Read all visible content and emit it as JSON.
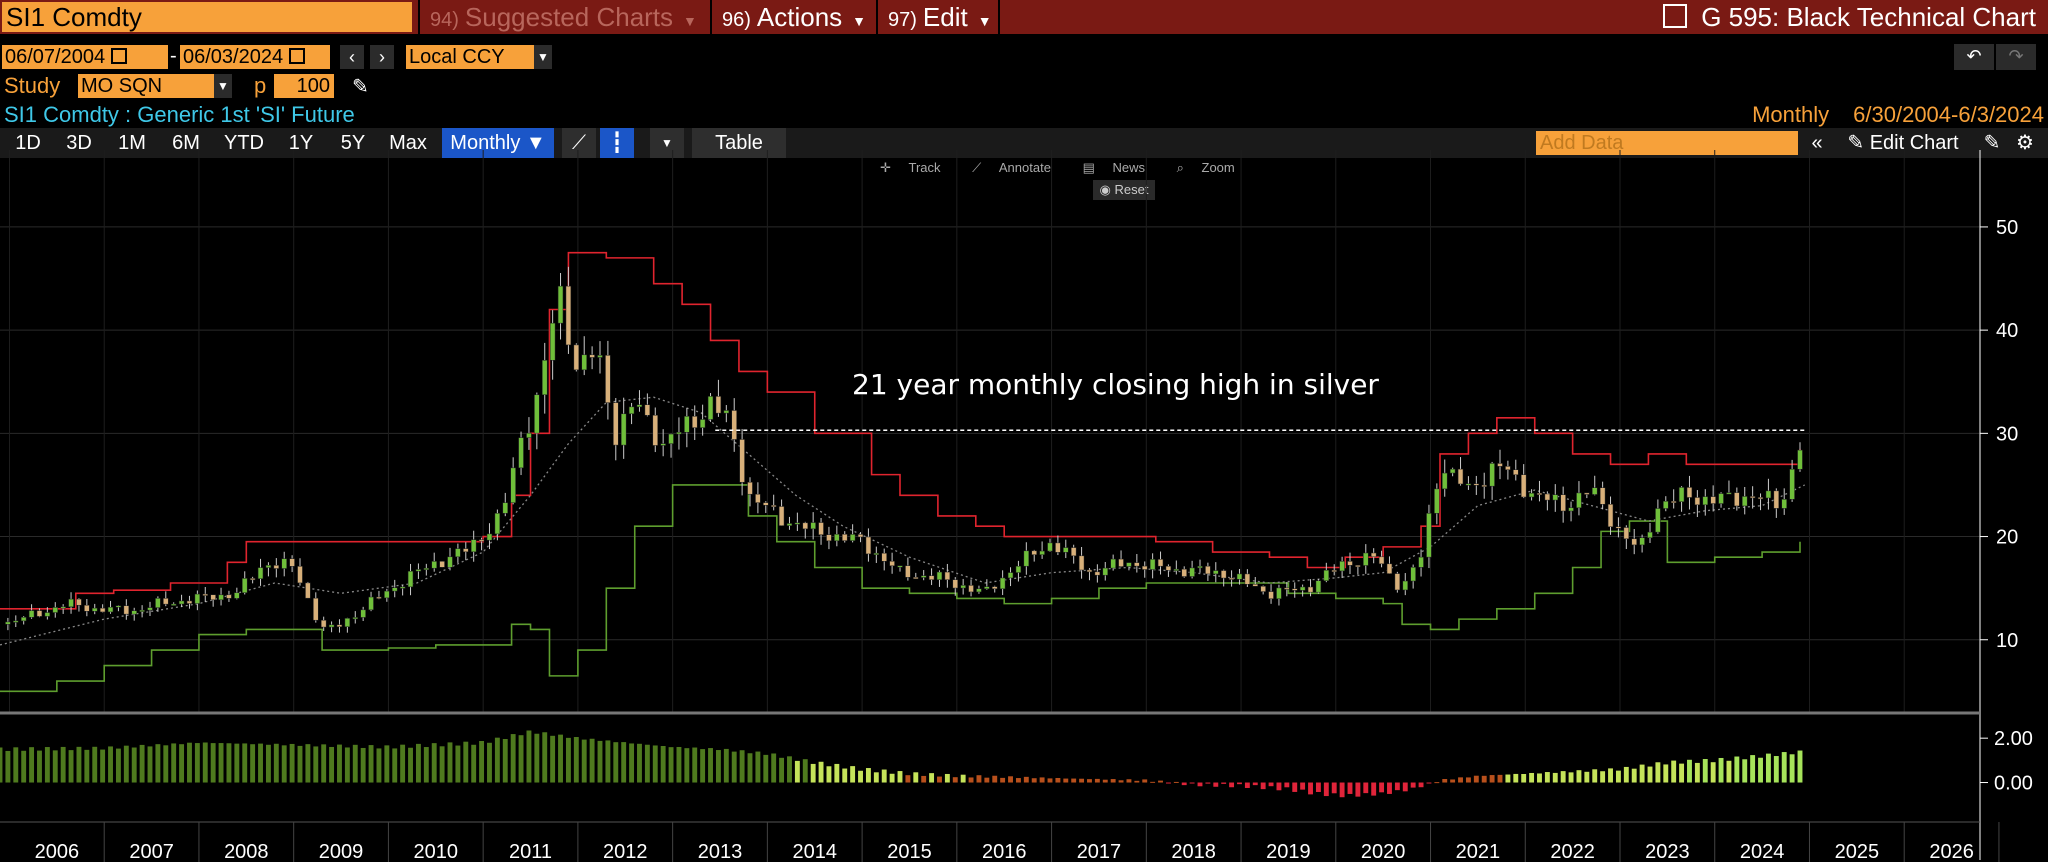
{
  "header": {
    "ticker": "SI1 Comdty",
    "menu_suggested_num": "94)",
    "menu_suggested": "Suggested Charts",
    "menu_actions_num": "96)",
    "menu_actions": "Actions",
    "menu_edit_num": "97)",
    "menu_edit": "Edit",
    "chart_title": "G 595: Black Technical Chart"
  },
  "controls": {
    "start_date": "06/07/2004",
    "end_date": "06/03/2024",
    "currency": "Local CCY",
    "study_label": "Study",
    "study_value": "MO SQN",
    "p_label": "p",
    "p_value": "100",
    "security_description": "SI1 Comdty : Generic 1st 'SI' Future",
    "frequency_label": "Monthly",
    "date_range": "6/30/2004-6/3/2024"
  },
  "toolbar": {
    "periods": [
      "1D",
      "3D",
      "1M",
      "6M",
      "YTD",
      "1Y",
      "5Y",
      "Max"
    ],
    "frequency_button": "Monthly",
    "table_button": "Table",
    "add_data_placeholder": "Add Data",
    "edit_chart": "Edit Chart",
    "chart_tools": [
      "Track",
      "Annotate",
      "News",
      "Zoom"
    ],
    "reset": "Reset"
  },
  "colors": {
    "accent_orange": "#f7a13a",
    "header_red": "#7a1a14",
    "upper_band": "#e0242e",
    "lower_band": "#5e9e2e",
    "up_candle": "#6fbf3a",
    "down_candle": "#d8b07a",
    "selected_blue": "#1b56c8"
  },
  "chart_data": {
    "type": "line",
    "description_series": "SI1 Comdty monthly candlestick with channel bands",
    "x_ticks": [
      "2006",
      "2007",
      "2008",
      "2009",
      "2010",
      "2011",
      "2012",
      "2013",
      "2014",
      "2015",
      "2016",
      "2017",
      "2018",
      "2019",
      "2020",
      "2021",
      "2022",
      "2023",
      "2024",
      "2025",
      "2026"
    ],
    "y_ticks": [
      10,
      20,
      30,
      40,
      50
    ],
    "ylim": [
      3,
      56
    ],
    "xlim": [
      2005.4,
      2026.3
    ],
    "annotation": "21 year monthly closing high in silver",
    "annotation_level": 30.3,
    "price_x": [
      2005.4,
      2005.8,
      2006.1,
      2006.4,
      2006.8,
      2007.1,
      2007.5,
      2007.9,
      2008.2,
      2008.5,
      2008.8,
      2008.95,
      2009.3,
      2009.7,
      2010.0,
      2010.3,
      2010.7,
      2010.9,
      2011.1,
      2011.3,
      2011.5,
      2011.7,
      2011.9,
      2012.1,
      2012.4,
      2012.7,
      2012.9,
      2013.1,
      2013.3,
      2013.6,
      2014.0,
      2014.5,
      2014.9,
      2015.3,
      2015.8,
      2016.1,
      2016.5,
      2016.9,
      2017.3,
      2017.8,
      2018.3,
      2018.8,
      2019.2,
      2019.6,
      2019.9,
      2020.2,
      2020.4,
      2020.6,
      2020.9,
      2021.2,
      2021.6,
      2021.9,
      2022.2,
      2022.5,
      2022.7,
      2022.9,
      2023.2,
      2023.5,
      2023.9,
      2024.2,
      2024.35,
      2024.45
    ],
    "price_y": [
      11.5,
      12.5,
      13.5,
      13.0,
      12.8,
      13.5,
      14.0,
      14.5,
      17.5,
      17.0,
      11.0,
      11.2,
      13.5,
      16.0,
      17.5,
      18.5,
      22.0,
      29.5,
      34.0,
      44.0,
      36.0,
      38.0,
      30.0,
      33.0,
      29.0,
      31.0,
      33.0,
      31.0,
      24.0,
      22.0,
      20.5,
      19.5,
      16.5,
      16.0,
      14.5,
      17.0,
      19.5,
      16.5,
      17.5,
      16.8,
      16.5,
      14.5,
      15.0,
      17.5,
      18.0,
      15.0,
      18.0,
      27.0,
      24.5,
      27.0,
      24.0,
      23.0,
      24.5,
      20.5,
      18.5,
      23.0,
      24.0,
      23.5,
      24.0,
      23.0,
      27.5,
      30.3
    ],
    "series": [
      {
        "name": "",
        "x": [
          2005.4,
          2006.2,
          2006.6,
          2007.2,
          2007.8,
          2008.0,
          2008.7,
          2009.2,
          2009.8,
          2010.2,
          2010.5,
          2010.8,
          2011.0,
          2011.2,
          2011.4,
          2011.8,
          2012.3,
          2012.6,
          2012.9,
          2013.2,
          2013.5,
          2013.8,
          2014.0,
          2014.3,
          2014.6,
          2014.9,
          2015.3,
          2015.7,
          2016.0,
          2016.5,
          2017.0,
          2017.6,
          2018.2,
          2018.8,
          2019.2,
          2019.6,
          2020.0,
          2020.4,
          2020.6,
          2020.9,
          2021.2,
          2021.6,
          2022.0,
          2022.4,
          2022.8,
          2023.2,
          2023.6,
          2024.0,
          2024.4
        ],
        "y": [
          13.0,
          14.5,
          14.8,
          15.5,
          17.5,
          19.5,
          19.5,
          19.5,
          19.5,
          19.5,
          20.0,
          24.0,
          30.0,
          42.0,
          47.5,
          47.0,
          44.5,
          42.5,
          39.0,
          36.0,
          34.0,
          34.0,
          30.0,
          30.0,
          26.0,
          24.0,
          22.0,
          21.0,
          20.0,
          20.0,
          20.0,
          19.5,
          18.5,
          18.0,
          17.0,
          18.0,
          19.0,
          21.0,
          28.0,
          30.0,
          31.5,
          30.0,
          28.0,
          27.0,
          28.0,
          27.0,
          27.0,
          27.0,
          28.5
        ]
      },
      {
        "name": "",
        "x": [
          2005.4,
          2006.0,
          2006.5,
          2007.0,
          2007.5,
          2008.0,
          2008.6,
          2008.8,
          2009.5,
          2010.0,
          2010.5,
          2010.8,
          2011.0,
          2011.2,
          2011.5,
          2011.8,
          2012.1,
          2012.5,
          2012.9,
          2013.3,
          2013.6,
          2014.0,
          2014.5,
          2015.0,
          2015.5,
          2016.0,
          2016.5,
          2017.0,
          2017.5,
          2018.0,
          2018.5,
          2019.0,
          2019.5,
          2020.0,
          2020.2,
          2020.5,
          2020.8,
          2021.2,
          2021.6,
          2022.0,
          2022.3,
          2022.6,
          2023.0,
          2023.5,
          2024.0,
          2024.4
        ],
        "y": [
          5.0,
          6.0,
          7.5,
          9.0,
          10.5,
          11.0,
          11.0,
          9.0,
          9.2,
          9.5,
          9.5,
          11.5,
          11.0,
          6.5,
          9.0,
          15.0,
          21.0,
          25.0,
          25.0,
          22.0,
          19.5,
          17.0,
          15.0,
          14.5,
          14.0,
          13.5,
          14.0,
          15.0,
          15.5,
          15.5,
          15.5,
          14.5,
          14.0,
          13.5,
          11.5,
          11.0,
          12.0,
          13.0,
          14.5,
          17.0,
          20.5,
          21.5,
          17.5,
          18.0,
          18.5,
          19.5
        ]
      },
      {
        "name": "",
        "x": [
          2005.4,
          2006.5,
          2007.5,
          2008.3,
          2009.0,
          2009.8,
          2010.5,
          2011.0,
          2011.4,
          2011.8,
          2012.3,
          2012.8,
          2013.3,
          2013.8,
          2014.3,
          2015.0,
          2015.8,
          2016.5,
          2017.3,
          2018.0,
          2018.8,
          2019.5,
          2020.0,
          2020.5,
          2021.0,
          2021.6,
          2022.2,
          2022.8,
          2023.4,
          2024.0,
          2024.45
        ],
        "y": [
          9.5,
          12.0,
          13.5,
          15.5,
          14.5,
          15.5,
          18.5,
          24.0,
          29.0,
          33.0,
          33.5,
          32.0,
          28.0,
          24.0,
          21.0,
          18.0,
          15.5,
          16.5,
          17.0,
          16.5,
          15.5,
          16.0,
          16.5,
          19.0,
          23.0,
          24.5,
          23.0,
          21.5,
          22.5,
          23.0,
          25.0
        ]
      }
    ],
    "volume_panel": {
      "y_ticks": [
        "2.00",
        "0.00"
      ],
      "ylim": [
        -1.6,
        3.0
      ],
      "x": [
        2005.4,
        2006.5,
        2007.5,
        2008.5,
        2009.5,
        2010.5,
        2011.0,
        2011.5,
        2012.0,
        2012.5,
        2013.0,
        2013.5,
        2014.0,
        2014.5,
        2015.0,
        2015.5,
        2016.0,
        2016.5,
        2017.0,
        2017.5,
        2018.0,
        2018.5,
        2019.0,
        2019.3,
        2019.6,
        2020.0,
        2020.3,
        2020.6,
        2021.0,
        2021.5,
        2022.0,
        2022.5,
        2023.0,
        2023.5,
        2024.0,
        2024.45
      ],
      "values": [
        1.5,
        1.55,
        1.8,
        1.7,
        1.6,
        1.8,
        2.3,
        2.0,
        1.8,
        1.6,
        1.5,
        1.3,
        0.9,
        0.6,
        0.4,
        0.3,
        0.25,
        0.2,
        0.15,
        0.1,
        -0.1,
        -0.15,
        -0.3,
        -0.5,
        -0.6,
        -0.5,
        -0.3,
        0.1,
        0.3,
        0.4,
        0.5,
        0.6,
        0.9,
        1.0,
        1.2,
        1.4
      ]
    }
  }
}
